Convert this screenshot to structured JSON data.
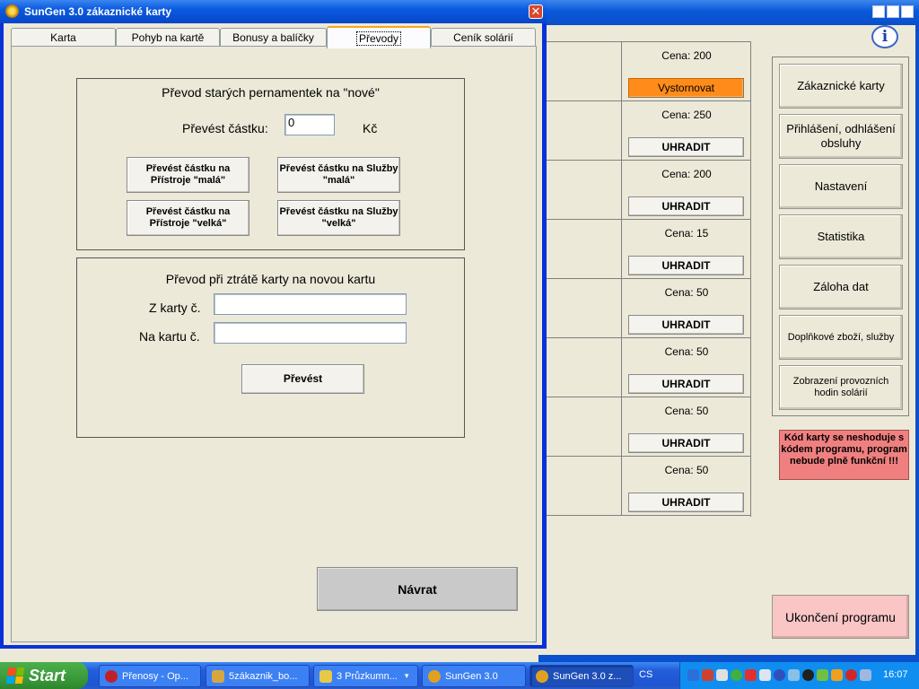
{
  "dialog": {
    "title": "SunGen 3.0 zákaznické karty",
    "close_glyph": "✕",
    "tabs": [
      {
        "label": "Karta"
      },
      {
        "label": "Pohyb na kartě"
      },
      {
        "label": "Bonusy a balíčky"
      },
      {
        "label": "Převody",
        "active": true
      },
      {
        "label": "Ceník solárií"
      }
    ],
    "group_old_passes": {
      "title": "Převod starých pernamentek na \"nové\"",
      "amount_label": "Převést částku:",
      "amount_value": "0",
      "currency": "Kč",
      "buttons": [
        "Převést částku na Přístroje \"malá\"",
        "Převést částku na Služby \"malá\"",
        "Převést částku na Přístroje \"velká\"",
        "Převést částku na Služby \"velká\""
      ]
    },
    "group_lost_card": {
      "title": "Převod při ztrátě karty na novou kartu",
      "from_label": "Z karty č.",
      "from_value": "",
      "to_label": "Na kartu č.",
      "to_value": "",
      "convert_button": "Převést"
    },
    "back_button": "Návrat"
  },
  "main_window": {
    "info_glyph": "i",
    "price_rows": [
      {
        "price": "Cena: 200",
        "button": "Vystornovat",
        "highlight": true
      },
      {
        "price": "Cena: 250",
        "button": "UHRADIT"
      },
      {
        "price": "Cena: 200",
        "button": "UHRADIT"
      },
      {
        "price": "Cena: 15",
        "button": "UHRADIT"
      },
      {
        "price": "Cena: 50",
        "button": "UHRADIT"
      },
      {
        "price": "Cena: 50",
        "button": "UHRADIT"
      },
      {
        "price": "Cena: 50",
        "button": "UHRADIT"
      },
      {
        "price": "Cena: 50",
        "button": "UHRADIT"
      }
    ],
    "menu": [
      "Zákaznické karty",
      "Přihlášení, odhlášení obsluhy",
      "Nastavení",
      "Statistika",
      "Záloha dat",
      "Doplňkové zboží, služby",
      "Zobrazení provozních hodin solárií"
    ],
    "warning": "Kód karty se neshoduje s kódem programu, program nebude plně funkční !!!",
    "exit_button": "Ukončení programu"
  },
  "taskbar": {
    "start_label": "Start",
    "tasks": [
      {
        "label": "Přenosy - Op...",
        "icon_color": "#c0202a"
      },
      {
        "label": "5zákaznik_bo...",
        "icon_color": "#d8a640"
      },
      {
        "label": "3 Průzkumn...",
        "icon_color": "#e8c84a",
        "has_dropdown": true
      },
      {
        "label": "SunGen 3.0",
        "icon_color": "#e0a020"
      },
      {
        "label": "SunGen 3.0 z...",
        "icon_color": "#e0a020",
        "active": true
      }
    ],
    "dropdown_glyph": "▾",
    "language": "CS",
    "clock": "16:07",
    "tray_icons": [
      "network-icon",
      "sound-icon",
      "display-icon",
      "antivirus-icon",
      "security-icon",
      "monitor-icon",
      "bluetooth-icon",
      "usb-icon",
      "power-icon",
      "messenger-icon",
      "update-icon",
      "media-icon",
      "volume-icon"
    ]
  },
  "colors": {
    "dialog_frame": "#0831d9",
    "highlight_button": "#ff8c1a",
    "warning_bg": "#f08080",
    "exit_bg": "#f9c5c5",
    "back_button_bg": "#c9c9c9"
  }
}
